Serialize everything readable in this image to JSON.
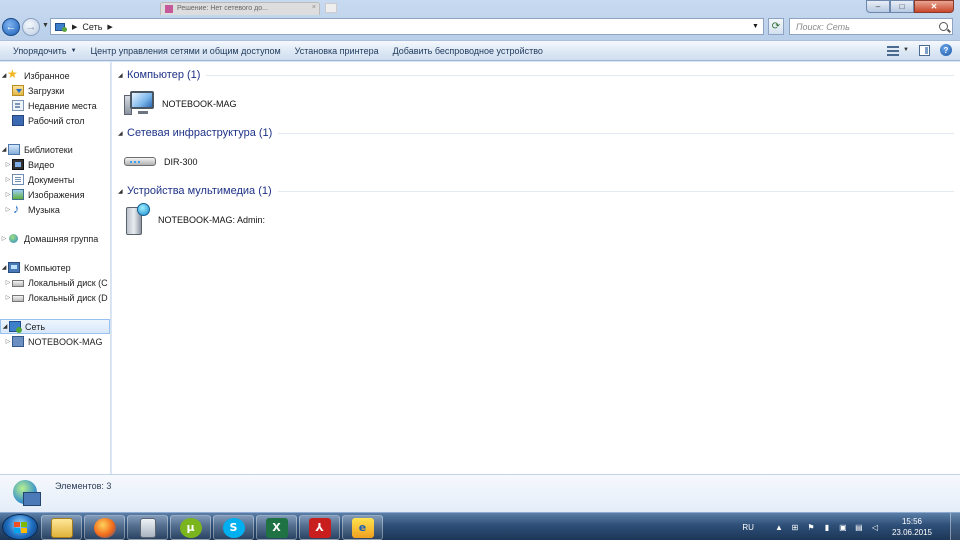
{
  "browser_tab": {
    "title": "Решение: Нет сетевого до..."
  },
  "window": {
    "controls": {
      "minimize": "‒",
      "maximize": "□",
      "close": "✕"
    }
  },
  "address": {
    "crumb": "Сеть",
    "search_placeholder": "Поиск: Сеть"
  },
  "command_bar": {
    "organize": "Упорядочить",
    "network_center": "Центр управления сетями и общим доступом",
    "add_printer": "Установка принтера",
    "add_wireless": "Добавить беспроводное устройство"
  },
  "nav": {
    "favorites": "Избранное",
    "downloads": "Загрузки",
    "recent": "Недавние места",
    "desktop": "Рабочий стол",
    "libraries": "Библиотеки",
    "video": "Видео",
    "documents": "Документы",
    "images": "Изображения",
    "music": "Музыка",
    "homegroup": "Домашняя группа",
    "computer": "Компьютер",
    "disk_c": "Локальный диск (C",
    "disk_d": "Локальный диск (D",
    "network": "Сеть",
    "notebook": "NOTEBOOK-MAG"
  },
  "groups": [
    {
      "title": "Компьютер (1)",
      "item": "NOTEBOOK-MAG",
      "icon": "computer-icon"
    },
    {
      "title": "Сетевая инфраструктура (1)",
      "item": "DIR-300",
      "icon": "router-icon"
    },
    {
      "title": "Устройства мультимедиа (1)",
      "item": "NOTEBOOK-MAG: Admin:",
      "icon": "media-server-icon"
    }
  ],
  "details": {
    "count": "Элементов: 3"
  },
  "taskbar": {
    "apps": [
      "explorer",
      "firefox",
      "calculator",
      "utorrent",
      "skype",
      "excel",
      "acrobat",
      "ie"
    ],
    "lang": "RU",
    "time": "15:56",
    "date": "23.06.2015"
  },
  "colors": {
    "accent": "#1e3287",
    "taskbar": "#2e4f78",
    "selection": "#d8e8fa"
  }
}
